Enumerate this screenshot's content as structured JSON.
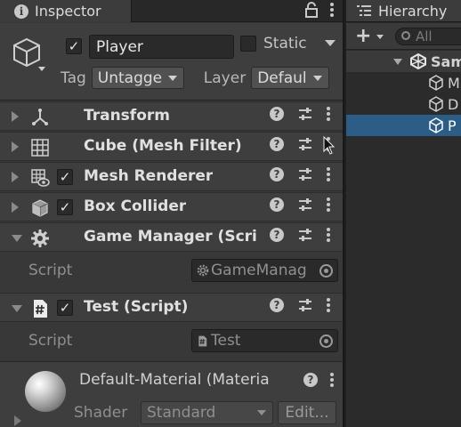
{
  "inspector": {
    "tab_title": "Inspector",
    "icons": [
      "info-icon",
      "lock-icon",
      "kebab-menu-icon"
    ]
  },
  "gameobject": {
    "active": true,
    "name": "Player",
    "static_label": "Static",
    "static_checked": false,
    "tag_label": "Tag",
    "tag_value": "Untagge",
    "layer_label": "Layer",
    "layer_value": "Defaul"
  },
  "components": [
    {
      "name": "Transform",
      "icon": "transform-icon",
      "has_checkbox": false,
      "expanded": false
    },
    {
      "name": "Cube (Mesh Filter)",
      "icon": "mesh-filter-icon",
      "has_checkbox": false,
      "expanded": false
    },
    {
      "name": "Mesh Renderer",
      "icon": "mesh-renderer-icon",
      "has_checkbox": true,
      "checked": true,
      "expanded": false
    },
    {
      "name": "Box Collider",
      "icon": "box-collider-icon",
      "has_checkbox": true,
      "checked": true,
      "expanded": false
    },
    {
      "name": "Game Manager (Scrip",
      "icon": "gear-icon",
      "has_checkbox": false,
      "expanded": true,
      "field_label": "Script",
      "field_value": "GameManag"
    },
    {
      "name": "Test (Script)",
      "icon": "script-hash-icon",
      "has_checkbox": true,
      "checked": true,
      "expanded": true,
      "field_label": "Script",
      "field_value": "Test"
    }
  ],
  "material": {
    "name": "Default-Material (Materia",
    "shader_label": "Shader",
    "shader_value": "Standard",
    "edit_label": "Edit..."
  },
  "hierarchy": {
    "tab_title": "Hierarchy",
    "search_placeholder": "All",
    "scene_name": "Sam",
    "items": [
      {
        "label": "M",
        "selected": false
      },
      {
        "label": "D",
        "selected": false
      },
      {
        "label": "P",
        "selected": true
      }
    ]
  },
  "colors": {
    "panel_bg": "#383838",
    "header_bg": "#3e3e3e",
    "selection": "#2c5d87"
  }
}
